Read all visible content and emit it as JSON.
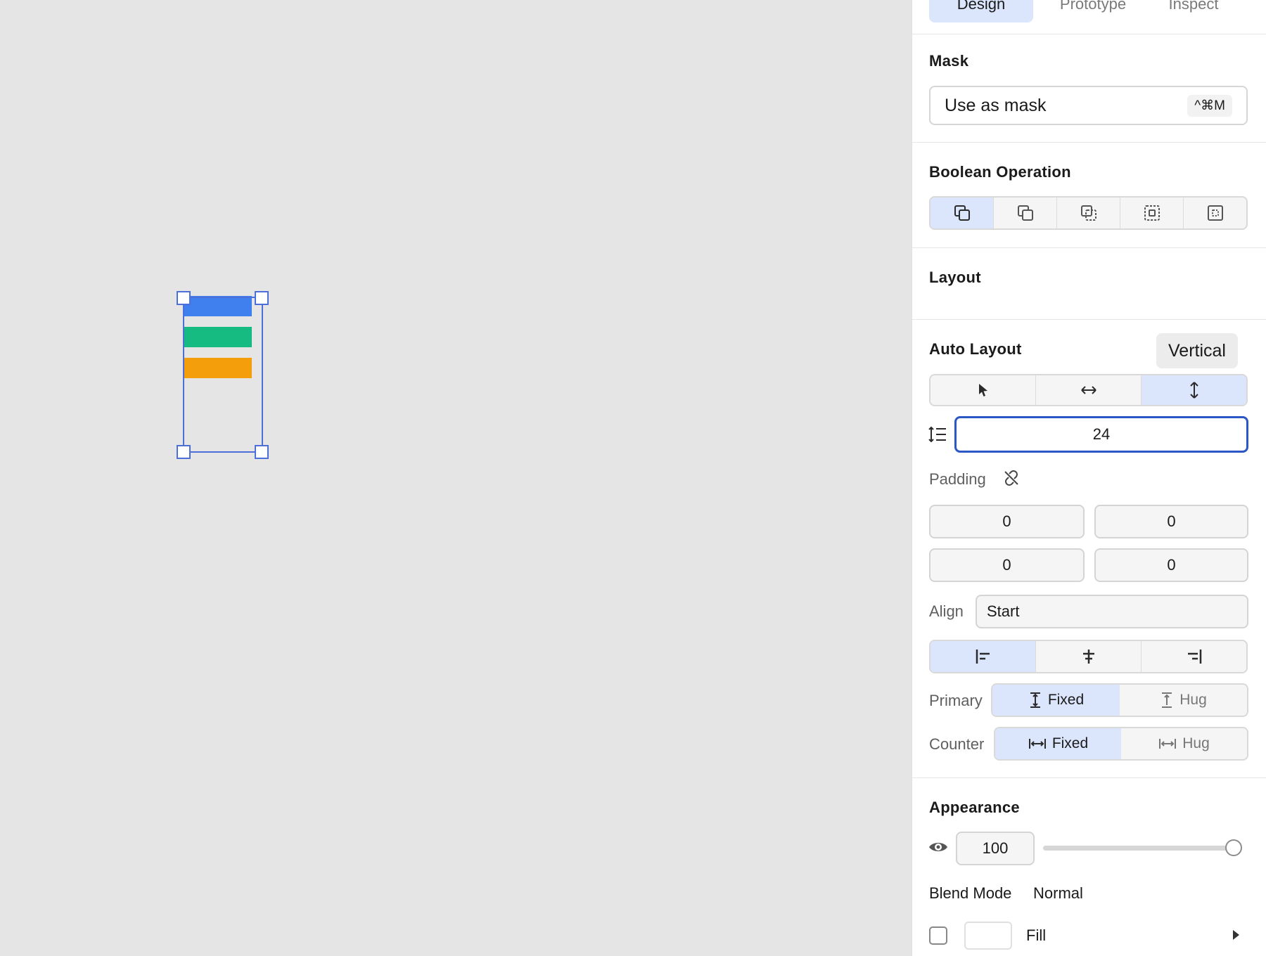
{
  "tabs": [
    {
      "label": "Design",
      "active": true
    },
    {
      "label": "Prototype",
      "active": false
    },
    {
      "label": "Inspect",
      "active": false
    }
  ],
  "mask": {
    "title": "Mask",
    "button_label": "Use as mask",
    "shortcut": "^⌘M"
  },
  "boolean": {
    "title": "Boolean Operation",
    "icons": [
      "union-icon",
      "subtract-icon",
      "intersect-icon",
      "exclude-icon",
      "flatten-icon"
    ],
    "selected_index": 0
  },
  "layout": {
    "title": "Layout"
  },
  "auto_layout": {
    "title": "Auto Layout",
    "tooltip": "Vertical",
    "direction_icons": [
      "pointer-icon",
      "horizontal-arrow-icon",
      "vertical-arrow-icon"
    ],
    "selected_direction": 2,
    "gap_value": "24",
    "padding_label": "Padding",
    "padding": [
      "0",
      "0",
      "0",
      "0"
    ],
    "align_label": "Align",
    "align_value": "Start",
    "align_icons": [
      "align-left-icon",
      "align-center-icon",
      "align-right-icon"
    ],
    "selected_align": 0,
    "primary_label": "Primary",
    "primary_options": [
      {
        "label": "Fixed",
        "active": true
      },
      {
        "label": "Hug",
        "active": false
      }
    ],
    "counter_label": "Counter",
    "counter_options": [
      {
        "label": "Fixed",
        "active": true
      },
      {
        "label": "Hug",
        "active": false
      }
    ]
  },
  "appearance": {
    "title": "Appearance",
    "opacity": "100",
    "opacity_fraction": 1.0,
    "blend_label": "Blend Mode",
    "blend_value": "Normal",
    "fill_label": "Fill"
  },
  "canvas": {
    "bar_colors": [
      "#3f7fee",
      "#16bb82",
      "#f59e0b"
    ],
    "selection_color": "#4c6fd9"
  }
}
